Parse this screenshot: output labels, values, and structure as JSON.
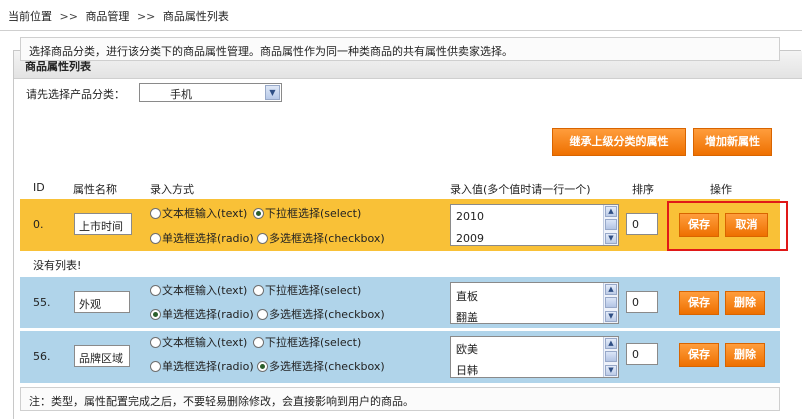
{
  "breadcrumb": {
    "items": [
      "当前位置",
      "商品管理",
      "商品属性列表"
    ],
    "separator": ">>"
  },
  "panel": {
    "title": "商品属性列表"
  },
  "info": {
    "text": "选择商品分类，进行该分类下的商品属性管理。商品属性作为同一种类商品的共有属性供卖家选择。"
  },
  "category": {
    "label": "请先选择产品分类：",
    "selected": "手机"
  },
  "actions": {
    "inherit_label": "继承上级分类的属性",
    "add_label": "增加新属性"
  },
  "table": {
    "headers": {
      "id": "ID",
      "name": "属性名称",
      "input_mode": "录入方式",
      "values": "录入值(多个值时请一行一个)",
      "order": "排序",
      "op": "操作"
    },
    "input_modes": {
      "text": "文本框输入(text)",
      "select": "下拉框选择(select)",
      "radio": "单选框选择(radio)",
      "checkbox": "多选框选择(checkbox)"
    },
    "rows": [
      {
        "id": "0.",
        "name": "上市时间",
        "mode": "select",
        "values": [
          "2010",
          "2009"
        ],
        "order": "0",
        "save_label": "保存",
        "second_label": "取消"
      },
      {
        "id": "55.",
        "name": "外观",
        "mode": "radio",
        "values": [
          "直板",
          "翻盖"
        ],
        "order": "0",
        "save_label": "保存",
        "second_label": "删除"
      },
      {
        "id": "56.",
        "name": "品牌区域",
        "mode": "checkbox",
        "values": [
          "欧美",
          "日韩"
        ],
        "order": "0",
        "save_label": "保存",
        "second_label": "删除"
      }
    ],
    "empty_text": "没有列表!"
  },
  "note": {
    "text": "注：类型，属性配置完成之后，不要轻易删除修改，会直接影响到用户的商品。"
  },
  "colors": {
    "editing_row": "#f9c137",
    "row_bg": "#b0d4ea",
    "button_orange": "#ee7000",
    "highlight": "#e01818"
  }
}
